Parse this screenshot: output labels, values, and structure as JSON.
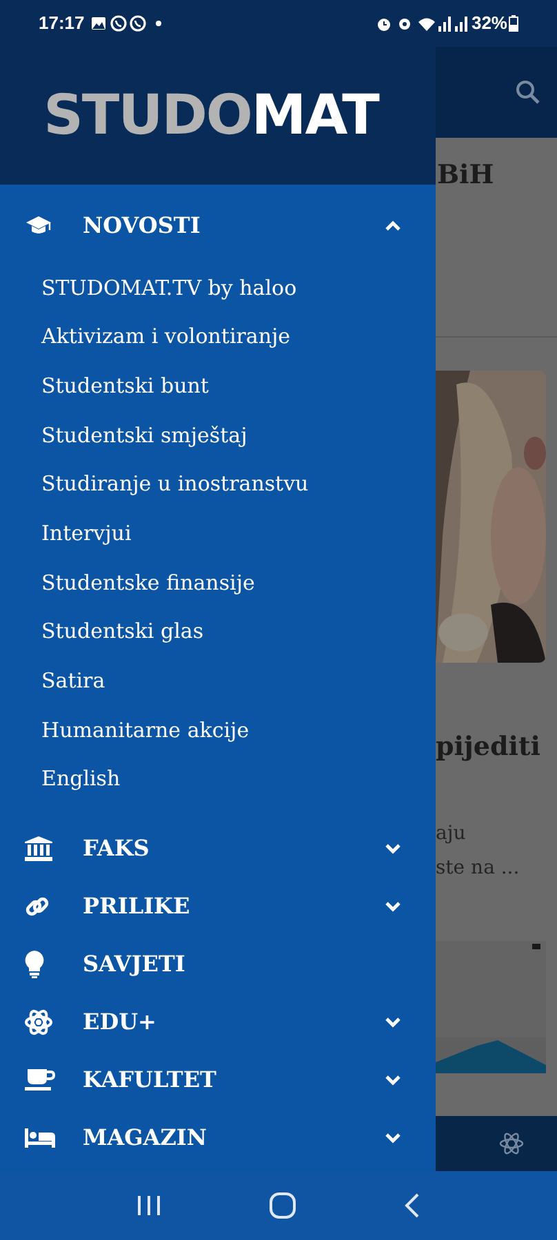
{
  "status_bar": {
    "time": "17:17",
    "battery": "32%"
  },
  "drawer": {
    "logo": {
      "part_1": "STUDO",
      "part_2": "MAT"
    },
    "menu": [
      {
        "label": "NOVOSTI",
        "kind": "group",
        "expanded": true,
        "children": [
          {
            "label": "STUDOMAT.TV by haloo"
          },
          {
            "label": "Aktivizam i volontiranje"
          },
          {
            "label": "Studentski bunt"
          },
          {
            "label": "Studentski smještaj"
          },
          {
            "label": "Studiranje u inostranstvu"
          },
          {
            "label": "Intervjui"
          },
          {
            "label": "Studentske finansije"
          },
          {
            "label": "Studentski glas"
          },
          {
            "label": "Satira"
          },
          {
            "label": "Humanitarne akcije"
          },
          {
            "label": "English"
          }
        ]
      },
      {
        "label": "FAKS",
        "kind": "group",
        "expanded": false
      },
      {
        "label": "PRILIKE",
        "kind": "group",
        "expanded": false
      },
      {
        "label": "SAVJETI",
        "kind": "link"
      },
      {
        "label": "EDU+",
        "kind": "group",
        "expanded": false
      },
      {
        "label": "KAFULTET",
        "kind": "group",
        "expanded": false
      },
      {
        "label": "MAGAZIN",
        "kind": "group",
        "expanded": false
      }
    ]
  },
  "background": {
    "headline_1": "BiH",
    "headline_2": "pijediti",
    "excerpt_line_1": "aju",
    "excerpt_line_2": "ste na ..."
  }
}
